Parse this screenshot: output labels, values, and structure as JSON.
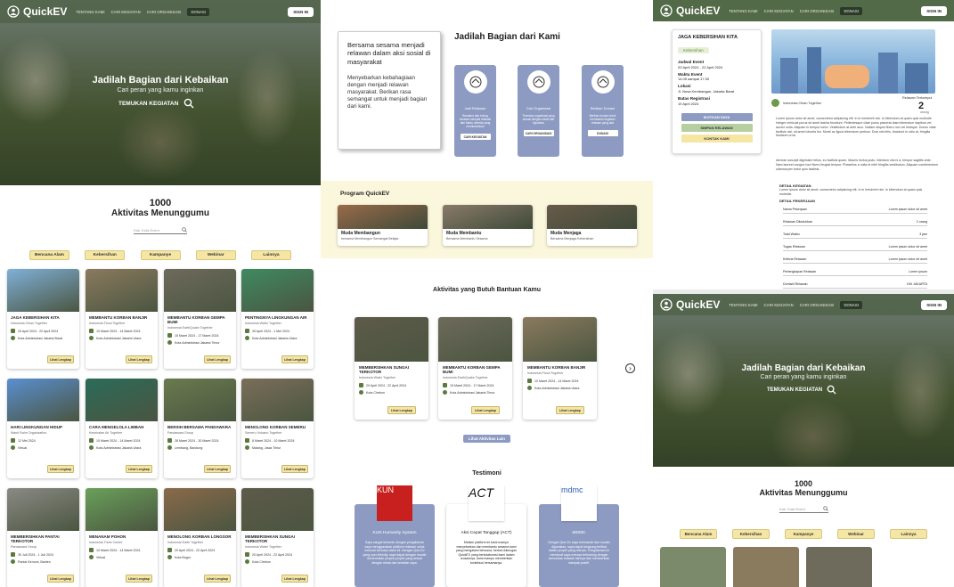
{
  "brand": "QuickEV",
  "nav": {
    "links": [
      "TENTANG KAMI",
      "CARI KEGIATAN",
      "CARI ORGANISASI"
    ],
    "donate": "DONASI",
    "signin": "SIGN IN"
  },
  "hero": {
    "title": "Jadilah Bagian dari Kebaikan",
    "subtitle": "Cari peran yang kamu inginkan",
    "button": "TEMUKAN KEGIATAN"
  },
  "activities": {
    "count": "1000",
    "label": "Aktivitas Menunggumu",
    "search_placeholder": "Kak, Kota Event"
  },
  "categories": [
    "Bencana Alam",
    "Kebersihan",
    "Kampanye",
    "Webinar",
    "Lainnya"
  ],
  "cards": [
    {
      "title": "JAGA KEBERSIHAN KITA",
      "org": "Indonesia Clean Together",
      "date": "20 April 2024 - 22 April 2024",
      "loc": "Kota Administrasi Jakarta Barat",
      "btn": "Lihat Lengkap",
      "color": "#7fb0d8"
    },
    {
      "title": "MEMBANTU KORBAN BANJIR",
      "org": "Indonesia Flood Together",
      "date": "10 Maret 2024 - 14 Maret 2024",
      "loc": "Kota Administrasi Jakarta Utara",
      "btn": "Lihat Lengkap",
      "color": "#8a7a5e"
    },
    {
      "title": "MEMBANTU KORBAN GEMPA BUMI",
      "org": "Indonesia EarthQuake Together",
      "date": "15 Maret 2024 - 17 Maret 2024",
      "loc": "Kota Administrasi Jakarta Timur",
      "btn": "Lihat Lengkap",
      "color": "#6e6a5c"
    },
    {
      "title": "PENTINGNYA LINGKUNGAN AIR",
      "org": "Indonesia Water Together",
      "date": "30 April 2024 - 1 Mei 2024",
      "loc": "Kota Administrasi Jakarta Utara",
      "btn": "Lihat Lengkap",
      "color": "#3f8a62"
    },
    {
      "title": "HARI LINGKUNGAN HIDUP",
      "org": "Wanit Swim Organization",
      "date": "12 Mei 2024",
      "loc": "Virtual",
      "btn": "Lihat Lengkap",
      "color": "#5a8fd0"
    },
    {
      "title": "CARA MENGELOLA LIMBAH",
      "org": "Kesehatan Air Together",
      "date": "10 Maret 2024 - 14 Maret 2024",
      "loc": "Kota Administrasi Jakarta Utara",
      "btn": "Lihat Lengkap",
      "color": "#2b6b5a"
    },
    {
      "title": "BERSIH BERSAMA PANDAWARA",
      "org": "Pandawara Group",
      "date": "28 Maret 2024 - 30 Maret 2024",
      "loc": "Lembang, Bandung",
      "btn": "Lihat Lengkap",
      "color": "#6a7a4e"
    },
    {
      "title": "MENOLONG KORBAN SEMERU",
      "org": "Semeru Volcano Together",
      "date": "8 Maret 2024 - 10 Maret 2024",
      "loc": "Malang, Jawa Timur",
      "btn": "Lihat Lengkap",
      "color": "#7a6e5a"
    },
    {
      "title": "MEMBERSIHKAN PANTAI TERKOTOR",
      "org": "Pandawara Group",
      "date": "30 Juli 2024 - 1 Juli 2024",
      "loc": "Pantai Kirmoni, Banten",
      "btn": "Lihat Lengkap",
      "color": "#8a8a84"
    },
    {
      "title": "MENANAM POHON",
      "org": "Indonesia Trees Center",
      "date": "10 Maret 2024 - 14 Maret 2024",
      "loc": "Virtual",
      "btn": "Lihat Lengkap",
      "color": "#6aa05a"
    },
    {
      "title": "MENOLONG KORBAN LONGSOR",
      "org": "Indonesia Earth Together",
      "date": "20 April 2024 - 22 April 2024",
      "loc": "Kota Bogor",
      "btn": "Lihat Lengkap",
      "color": "#8a6a4a"
    },
    {
      "title": "MEMBERSIHKAN SUNGAI TERKOTOR",
      "org": "Indonesia Water Together",
      "date": "20 April 2024 - 22 April 2024",
      "loc": "Kota Cirebon",
      "btn": "Lihat Lengkap",
      "color": "#5e5a4a"
    }
  ],
  "note": {
    "heading": "Bersama sesama menjadi relawan dalam aksi sosial di masyarakat",
    "body": "Menyebarkan kebahagiaan dengan menjadi relawan masyarakat. Berikan rasa semangat untuk menjadi bagian dari kami."
  },
  "roles": {
    "title": "Jadilah Bagian dari Kami",
    "items": [
      {
        "name": "Jadi Relawan",
        "desc": "Bersama dan tolong sesama menjadi relawan dan bantu mereka yang membutuhkan",
        "btn": "CARI KEGIATAN"
      },
      {
        "name": "Cari Organisasi",
        "desc": "Temukan organisasi yang sesuai dengan minat dan tujuanmu",
        "btn": "CARI ORGANISASI"
      },
      {
        "name": "Berikan Donasi",
        "desc": "Berikan donasi untuk membantu kegiatan relawan yang ada",
        "btn": "DONASI"
      }
    ]
  },
  "program": {
    "title": "Program QuickEV",
    "items": [
      {
        "name": "Muda Membangun",
        "desc": "bersama Membangun Semangat Belajar",
        "color": "#9a6a4a"
      },
      {
        "name": "Muda Membantu",
        "desc": "Bersama Membantu Sesama",
        "color": "#8a7a6a"
      },
      {
        "name": "Muda Menjaga",
        "desc": "Bersama Menjaga Kebersihan",
        "color": "#6a5a4a"
      }
    ]
  },
  "need_help": {
    "title": "Aktivitas yang Butuh Bantuan Kamu",
    "more": "Lihat Aktivitas Lain",
    "items": [
      {
        "title": "MEMBERSIHKAN SUNGAI TERKOTOR",
        "org": "Indonesia Water Together",
        "date": "20 April 2024 - 22 April 2024",
        "loc": "Kota Cirebon",
        "btn": "Lihat Lengkap",
        "color": "#5e5a4a"
      },
      {
        "title": "MEMBANTU KORBAN GEMPA BUMI",
        "org": "Indonesia EarthQuake Together",
        "date": "15 Maret 2024 - 17 Maret 2024",
        "loc": "Kota Administrasi Jakarta Timur",
        "btn": "Lihat Lengkap",
        "color": "#6e6a5c"
      },
      {
        "title": "MEMBANTU KORBAN BANJIR",
        "org": "Indonesia Flood Together",
        "date": "10 Maret 2024 - 14 Maret 2024",
        "loc": "Kota Administrasi Jakarta Utara",
        "btn": "Lihat Lengkap",
        "color": "#8a7a5e"
      }
    ]
  },
  "testimoni": {
    "title": "Testimoni",
    "items": [
      {
        "logo": "KUN",
        "name": "KUN Humanity System",
        "text": "Saya sangat terbantu dengan pengalaman saya menggunakan platform relawan untuk mencari bencana alam ini. Dengan Quic Ev yang user-friendly, saya dapat dengan mudah menemukan proyek-proyek yang sesuai dengan minat dan keahlian saya.",
        "bg": "#8d9bc3",
        "logo_bg": "#c8201e"
      },
      {
        "logo": "ACT",
        "name": "Aksi Cepat Tanggap (ACT)",
        "text": "Melalui platform ini kami mampu menyebarkan dan membantu sesama kami yang mengalami bencana, berkat dukungan QuickEV yang berkolaborasi kami dalam urusannya, kami mampu memberikan kontribusi bersamanya.",
        "bg": "#ffffff",
        "logo_bg": "#ffffff"
      },
      {
        "logo": "mdmc",
        "name": "MDMC",
        "text": "Dengan Quic Ev saya memasuki dan mudah digunakan, saya dapat langsung terlibat dalam proyek yang relevan. Pengalaman ini membuat saya merasa terhubung dengan komunitas relawan lainnya dan memberikan dampak positif.",
        "bg": "#8d9bc3",
        "logo_bg": "#ffffff"
      }
    ]
  },
  "detail": {
    "title": "JAGA KEBERSIHAN KITA",
    "tag": "Kebersihan",
    "event_label": "Jadwal Event",
    "event_date": "20 April 2024 - 22 April 2024",
    "time_label": "Waktu Event",
    "time": "14.05 sampai 17.00",
    "loc_label": "Lokasi",
    "loc": "Jl. Nusa Kembangan, Jakarta Barat",
    "reg_label": "Batas Registrasi",
    "reg": "19 April 2024",
    "btn_join": "IKUTKAN SAYA",
    "btn_save": "SIMPAN RELAWAN",
    "btn_contact": "KONTAK KAMI",
    "org": "Indonesia Clean Together",
    "needed_label": "Relawan Terkumpul",
    "needed": "2",
    "needed_unit": "orang",
    "para1": "Lorem ipsum dolor sit amet, consectetur adipiscing elit. In in hendrerit nisi. In bibendum at quam quis molestie. Integer vehicula purus sit amet lacinia tincidunt. Pellentesque vitae purus placerat diam bibendum dapibus vel auctor nulla. Aliquam in tempor tortor. Vestibulum at ante arcu. Nullam aliquet libero non vel tristique. Donec vitae facilisis nisl, sit amet lobortis leo. Morbi ac ligula bibendum pretium. Duis nisl felis, tincidunt in odio at, fringilla tincidunt urna.",
    "para2": "Aenean suscipit dignissim tellus, eu facilisis quam. Mauris lectus justo, interdum nisl ni a, tempor sagittis ante. Nam laoreet congue tour libero feugiat tempor. Phasellus a nulla et nibh fringilla vestibulum. Aliquam condimentum ullamcorper tortor quis facilisis.",
    "detail_label": "DETAIL KEGIATAN",
    "detail_text": "Lorem ipsum dolor sit amet, consectetur adipiscing elit. In in hendrerit nisi. In bibendum at quam quis molestie.",
    "job_label": "DETAIL PEKERJAAN",
    "rows": [
      [
        "Nama Pekerjaan",
        "Lorem ipsum dolor sit amet"
      ],
      [
        "Relawan Dibutuhkan",
        "2 orang"
      ],
      [
        "Total Waktu",
        "3 jam"
      ],
      [
        "Tugas Relawan",
        "Lorem ipsum dolor sit amet"
      ],
      [
        "Kriteria Relawan",
        "Lorem ipsum dolor sit amet"
      ],
      [
        "Perlengkapan Relawan",
        "Lorem ipsum"
      ],
      [
        "Domisili Relawan",
        "DKI JAKARTA"
      ]
    ]
  },
  "colors": {
    "accent": "#f6e6a4",
    "blue": "#8d9bc3",
    "nav": "#506246"
  }
}
